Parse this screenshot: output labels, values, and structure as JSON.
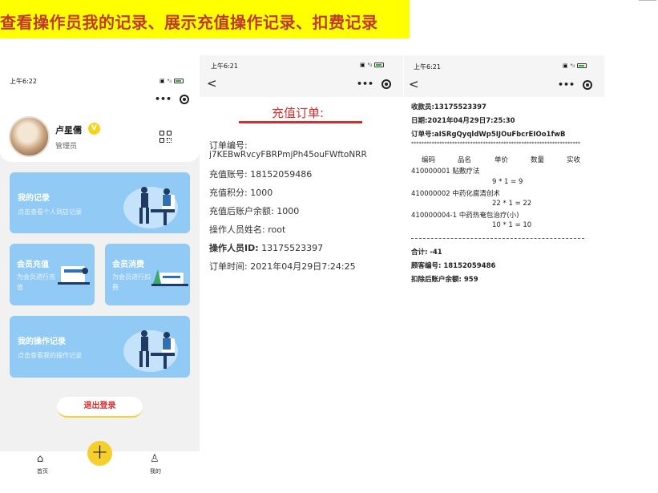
{
  "banner": {
    "title": "查看操作员我的记录、展示充值操作记录、扣费记录"
  },
  "common": {
    "time": "上午6:21",
    "capsule_dots": "•••",
    "back": "<"
  },
  "phone1": {
    "time": "上午6:22",
    "user": {
      "name": "卢星儒",
      "role": "管理员",
      "vip": "V"
    },
    "cards": {
      "my_records": {
        "title": "我的记录",
        "sub": "点击查看个人到店记录"
      },
      "recharge": {
        "title": "会员充值",
        "sub": "为会员进行充值"
      },
      "consume": {
        "title": "会员消费",
        "sub": "为会员进行扣费"
      },
      "ops": {
        "title": "我的操作记录",
        "sub": "点击查看我的操作记录"
      }
    },
    "logout": "退出登录",
    "tabs": {
      "home": "首页",
      "add": "+",
      "me": "我的"
    }
  },
  "phone2": {
    "title": "充值订单:",
    "order_no_label": "订单编号:",
    "order_no": "j7KEBwRvcyFBRPmjPh45ouFWftoNRR",
    "account": "充值账号:  18152059486",
    "points": "充值积分:  1000",
    "balance": "充值后账户余额:  1000",
    "operator_name": "操作人员姓名: root",
    "operator_id_label": "操作人员ID:",
    "operator_id": " 13175523397",
    "order_time_label": "订单时间:",
    "order_time": " 2021年04月29日7:24:25"
  },
  "phone3": {
    "cashier": "收款员:13175523397",
    "date": "日期:2021年04月29日7:25:30",
    "order_no": "订单号:aISRgQyqldWp5IJOuFbcrEIOo1fwB",
    "stars": "******************************************************************",
    "headers": [
      "编码",
      "品名",
      "单价",
      "数量",
      "实收"
    ],
    "items": [
      {
        "name": "410000001 贴敷疗法",
        "calc": "9  *  1  =  9"
      },
      {
        "name": "410000002 中药化腐清创术",
        "calc": "22  *  1  =  22"
      },
      {
        "name": "410000004-1 中药热奄包治疗(小)",
        "calc": "10  *  1  =  10"
      }
    ],
    "total": "合计: -41",
    "customer": "顾客编号: 18152059486",
    "balance_after": "扣除后账户余额: 959"
  },
  "colors": {
    "card": "#90caf5",
    "accent_red": "#d32f2f",
    "banner": "#ffff00",
    "fab": "#f5cf2c"
  }
}
